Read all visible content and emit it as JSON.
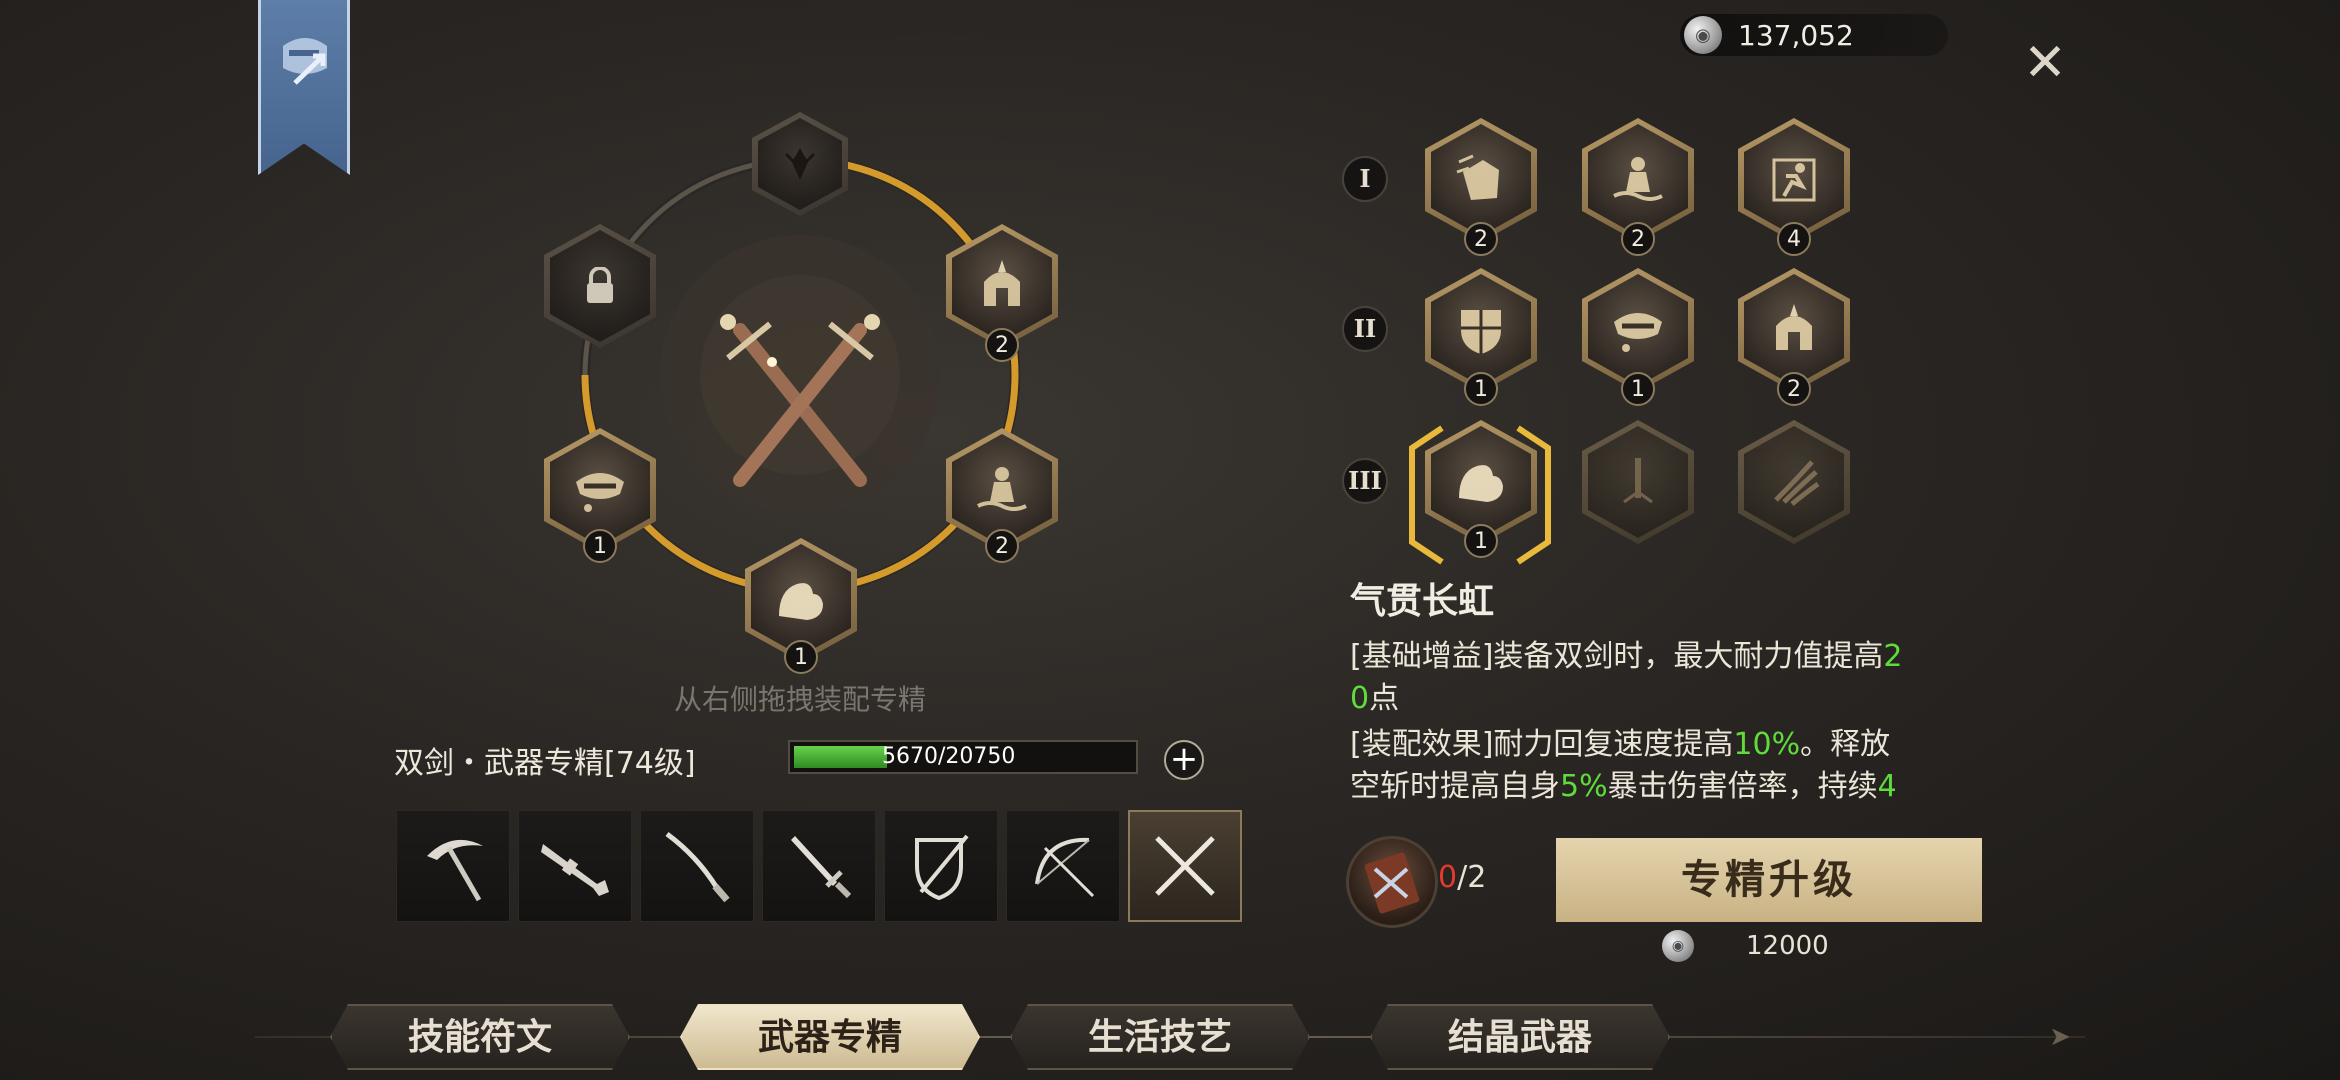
{
  "currency": {
    "amount": "137,052",
    "coin_icon": "silver-coin-icon"
  },
  "ring": {
    "badges": {
      "right_top": "2",
      "left_bottom": "1",
      "right_bottom": "2",
      "bottom": "1"
    }
  },
  "drag_hint": "从右侧拖拽装配专精",
  "weapon": {
    "title": "双剑・武器专精[74级]",
    "xp_text": "5670/20750",
    "xp_fraction": 0.273
  },
  "weapons": [
    "scythe",
    "rifle",
    "katana",
    "sword",
    "sword-shield",
    "bow",
    "dual-swords"
  ],
  "tiers": [
    {
      "roman": "I",
      "badges": [
        "2",
        "2",
        "4"
      ]
    },
    {
      "roman": "II",
      "badges": [
        "1",
        "1",
        "2"
      ]
    },
    {
      "roman": "III",
      "badges": [
        "1"
      ]
    }
  ],
  "skill": {
    "name": "气贯长虹",
    "line1_a": "[基础增益]装备双剑时，最大耐力值提高",
    "line1_g1": "2",
    "line1_g2": "0",
    "line1_b": "点",
    "line2_a": "[装配效果]耐力回复速度提高",
    "line2_g1": "10%",
    "line2_b": "。释放",
    "line3_a": "空斩时提高自身",
    "line3_g1": "5%",
    "line3_b": "暴击伤害倍率，持续",
    "line3_g2": "4"
  },
  "upgrade": {
    "have": "0",
    "need": "/2",
    "label": "专精升级",
    "cost": "12000"
  },
  "tabs": [
    "技能符文",
    "武器专精",
    "生活技艺",
    "结晶武器"
  ],
  "colors": {
    "accent_gold": "#d4a244",
    "xp_green": "#5fdc3c",
    "text_highlight_green": "#5fdc3c"
  }
}
